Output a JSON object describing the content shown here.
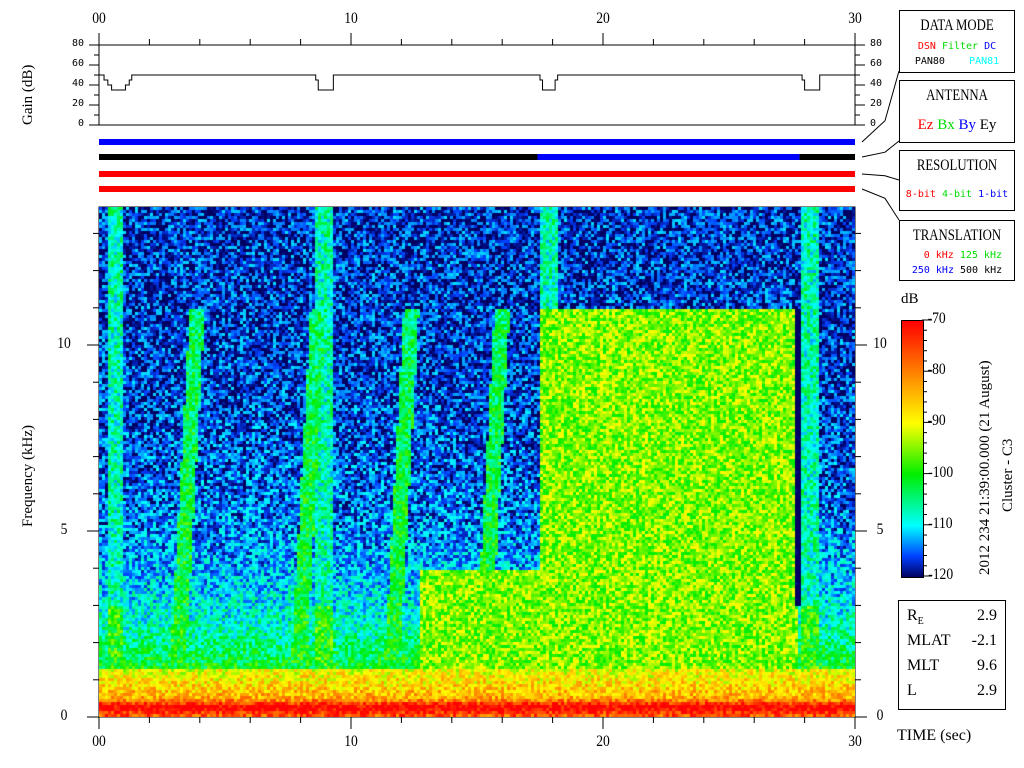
{
  "chart_data": {
    "type": "heatmap",
    "title": "2012 234 21:39:00.000 (21 August)",
    "spacecraft": "Cluster - C3",
    "xlabel": "TIME (sec)",
    "ylabel": "Frequency (kHz)",
    "xlim": [
      0,
      30
    ],
    "ylim": [
      0,
      13.7
    ],
    "x_ticks": [
      "00",
      "10",
      "20",
      "30"
    ],
    "y_ticks": [
      "0",
      "5",
      "10"
    ],
    "colorbar": {
      "label": "dB",
      "range": [
        -120,
        -70
      ],
      "ticks": [
        "-70",
        "-80",
        "-90",
        "-100",
        "-110",
        "-120"
      ]
    },
    "features": {
      "low_band_kHz": 0.3,
      "low_band_dB": -72,
      "broadband_region": {
        "t": [
          17.4,
          27.7
        ],
        "f_max_kHz": 11,
        "dB": -95
      },
      "dark_gap": {
        "t": [
          27.55,
          27.75
        ],
        "f": [
          3,
          11
        ]
      },
      "bursts_t": [
        0.6,
        8.9,
        17.8,
        28.2
      ],
      "streaks_t": [
        3.2,
        8.0,
        11.7,
        15.3
      ]
    },
    "gain": {
      "ylabel": "Gain (dB)",
      "ylim": [
        0,
        80
      ],
      "y_ticks": [
        "0",
        "20",
        "40",
        "60",
        "80"
      ],
      "t": [
        0,
        0.2,
        0.35,
        0.5,
        0.9,
        1.05,
        1.2,
        1.3,
        8.5,
        8.6,
        8.7,
        9.2,
        9.3,
        17.4,
        17.5,
        17.6,
        18.0,
        18.1,
        18.2,
        27.8,
        27.9,
        28.0,
        28.5,
        28.6,
        30
      ],
      "values": [
        50,
        45,
        40,
        35,
        35,
        40,
        45,
        50,
        50,
        45,
        35,
        35,
        50,
        50,
        45,
        35,
        35,
        45,
        50,
        50,
        45,
        35,
        35,
        50,
        50
      ]
    },
    "status_bars": [
      {
        "segments": [
          {
            "t": [
              0,
              30
            ],
            "color": "#0000ff"
          }
        ]
      },
      {
        "segments": [
          {
            "t": [
              0,
              17.4
            ],
            "color": "#000000"
          },
          {
            "t": [
              17.4,
              27.8
            ],
            "color": "#0000ff"
          },
          {
            "t": [
              27.8,
              30
            ],
            "color": "#000000"
          }
        ]
      },
      {
        "segments": [
          {
            "t": [
              0,
              30
            ],
            "color": "#ff0000"
          }
        ]
      },
      {
        "segments": [
          {
            "t": [
              0,
              30
            ],
            "color": "#ff0000"
          }
        ]
      }
    ]
  },
  "legend": {
    "data_mode": {
      "title": "DATA MODE",
      "items": [
        {
          "t": "DSN",
          "c": "#ff0000"
        },
        {
          "t": "Filter",
          "c": "#00dd00"
        },
        {
          "t": "DC",
          "c": "#0000ff"
        },
        {
          "t": "PAN80",
          "c": "#000000"
        },
        {
          "t": "PAN81",
          "c": "#00ffff"
        }
      ]
    },
    "antenna": {
      "title": "ANTENNA",
      "items": [
        {
          "t": "Ez",
          "c": "#ff0000"
        },
        {
          "t": "Bx",
          "c": "#00dd00"
        },
        {
          "t": "By",
          "c": "#0000ff"
        },
        {
          "t": "Ey",
          "c": "#000000"
        }
      ]
    },
    "resolution": {
      "title": "RESOLUTION",
      "items": [
        {
          "t": "8-bit",
          "c": "#ff0000"
        },
        {
          "t": "4-bit",
          "c": "#00dd00"
        },
        {
          "t": "1-bit",
          "c": "#0000ff"
        }
      ]
    },
    "translation": {
      "title": "TRANSLATION",
      "items": [
        {
          "t": "0 kHz",
          "c": "#ff0000"
        },
        {
          "t": "125 kHz",
          "c": "#00dd00"
        },
        {
          "t": "250 kHz",
          "c": "#0000ff"
        },
        {
          "t": "500 kHz",
          "c": "#000000"
        }
      ]
    }
  },
  "ephemeris": [
    {
      "k": "R",
      "sub": "E",
      "v": "2.9"
    },
    {
      "k": "MLAT",
      "sub": "",
      "v": "-2.1"
    },
    {
      "k": "MLT",
      "sub": "",
      "v": "9.6"
    },
    {
      "k": "L",
      "sub": "",
      "v": "2.9"
    }
  ]
}
